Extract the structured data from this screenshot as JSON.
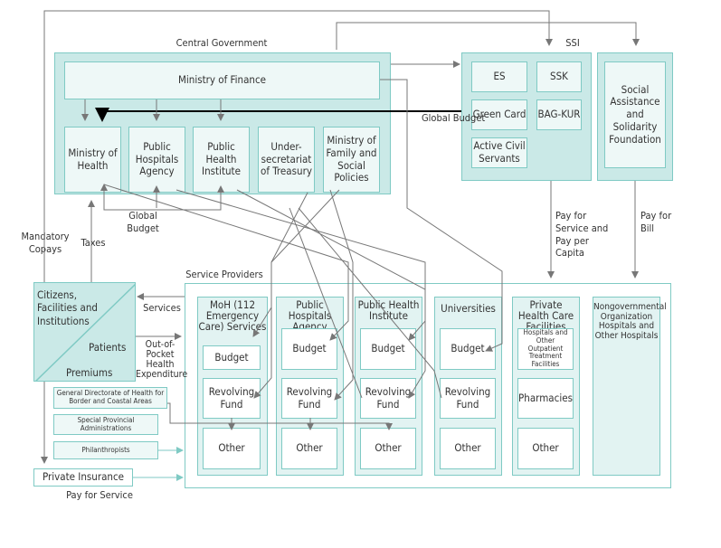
{
  "central_government": {
    "title": "Central Government",
    "finance": "Ministry of Finance",
    "ministries": [
      "Ministry of Health",
      "Public Hospitals Agency",
      "Public Health Institute",
      "Under-secretariat of Treasury",
      "Ministry of Family and Social Policies"
    ]
  },
  "ssi": {
    "title": "SSI",
    "items": [
      "ES",
      "SSK",
      "Green Card",
      "BAG-KUR",
      "Active Civil Servants"
    ]
  },
  "social_assistance": "Social Assistance and Solidarity Foundation",
  "citizens": {
    "top": "Citizens, Facilities and Institutions",
    "patients": "Patients",
    "premiums": "Premiums"
  },
  "funders": [
    "General Directorate of Health for Border and Coastal Areas",
    "Special Provincial Administrations",
    "Philanthropists"
  ],
  "private_insurance": "Private Insurance",
  "providers": {
    "title": "Service Providers",
    "columns": [
      {
        "title": "MoH (112 Emergency Care) Services",
        "cells": [
          "Budget",
          "Revolving Fund",
          "Other"
        ]
      },
      {
        "title": "Public Hospitals Agency",
        "cells": [
          "Budget",
          "Revolving Fund",
          "Other"
        ]
      },
      {
        "title": "Public Health Institute",
        "cells": [
          "Budget",
          "Revolving Fund",
          "Other"
        ]
      },
      {
        "title": "Universities",
        "cells": [
          "Budget",
          "Revolving Fund",
          "Other"
        ]
      },
      {
        "title": "Private Health Care Facilities",
        "cells": [
          "Hospitals and Other Outpatient Treatment Facilities",
          "Pharmacies",
          "Other"
        ]
      },
      {
        "title": "Nongovernmental Organization Hospitals and Other Hospitals",
        "cells": []
      }
    ]
  },
  "labels": {
    "global_budget_right": "Global Budget",
    "global_budget_bottom": "Global Budget",
    "mandatory_copays": "Mandatory Copays",
    "taxes": "Taxes",
    "services": "Services",
    "out_of_pocket": "Out-of-Pocket Health Expenditure",
    "pay_service_capita": "Pay for Service and Pay per Capita",
    "pay_bill": "Pay for Bill",
    "pay_for_service": "Pay for Service"
  },
  "colors": {
    "box_fill": "#cae9e7",
    "box_border": "#7fcac4",
    "inner_fill": "#eef8f7",
    "arrow": "#777777"
  }
}
